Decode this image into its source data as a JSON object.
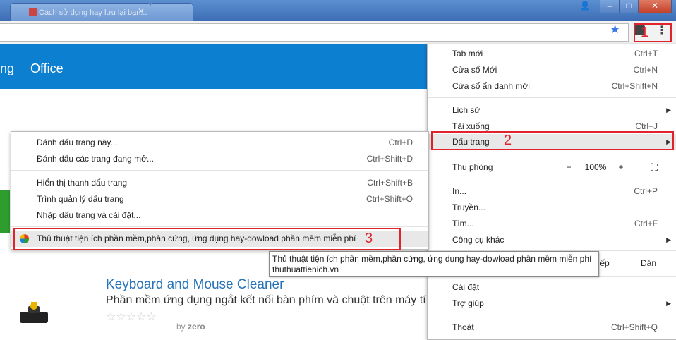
{
  "browser": {
    "tab_title": "Cách sử dụng hay lưu lại bạn...",
    "tab2_text": "",
    "window_buttons": {
      "user": "👤",
      "minimize": "–",
      "maximize": "□",
      "close": "✕"
    },
    "star_icon": "star-icon",
    "menu_icon": "⋮"
  },
  "annotations": {
    "n1": "1",
    "n2": "2",
    "n3": "3",
    "color": "#e0232d"
  },
  "site_nav": {
    "item_partial": "ng",
    "item_office": "Office",
    "color": "#0d7fd0"
  },
  "chrome_menu": {
    "items": [
      {
        "label": "Tab mới",
        "shortcut": "Ctrl+T"
      },
      {
        "label": "Cửa sổ Mới",
        "shortcut": "Ctrl+N"
      },
      {
        "label": "Cửa sổ ẩn danh mới",
        "shortcut": "Ctrl+Shift+N"
      },
      {
        "label": "Lịch sử",
        "shortcut": ""
      },
      {
        "label": "Tải xuống",
        "shortcut": "Ctrl+J"
      },
      {
        "label": "Dấu trang",
        "shortcut": ""
      }
    ],
    "zoom": {
      "label": "Thu phóng",
      "minus": "−",
      "value": "100%",
      "plus": "+"
    },
    "items2": [
      {
        "label": "In...",
        "shortcut": "Ctrl+P"
      },
      {
        "label": "Truyền...",
        "shortcut": ""
      },
      {
        "label": "Tìm...",
        "shortcut": "Ctrl+F"
      },
      {
        "label": "Công cụ khác",
        "shortcut": ""
      }
    ],
    "edit": {
      "paste": "ếp",
      "paste_full": "Dán"
    },
    "items3": [
      {
        "label": "Cài đặt"
      },
      {
        "label": "Trợ giúp"
      }
    ],
    "exit": {
      "label": "Thoát",
      "shortcut": "Ctrl+Shift+Q"
    }
  },
  "bookmarks_submenu": {
    "items": [
      {
        "label": "Đánh dấu trang này...",
        "shortcut": "Ctrl+D"
      },
      {
        "label": "Đánh dấu các trang đang mở...",
        "shortcut": "Ctrl+Shift+D"
      },
      {
        "label": "Hiển thị thanh dấu trang",
        "shortcut": "Ctrl+Shift+B"
      },
      {
        "label": "Trình quản lý dấu trang",
        "shortcut": "Ctrl+Shift+O"
      },
      {
        "label": "Nhập dấu trang và cài đặt...",
        "shortcut": ""
      }
    ],
    "bookmark": {
      "label": "Thủ thuật tiện ích phần mềm,phần cứng, ứng dụng hay-dowload phần mềm miễn phí"
    }
  },
  "tooltip": {
    "line1": "Thủ thuật tiện ích phần mềm,phần cứng, ứng dụng hay-dowload phần mềm miễn phí",
    "line2": "thuthuattienich.vn"
  },
  "page_content": {
    "title": "Keyboard and Mouse Cleaner",
    "description": "Phần mềm ứng dụng ngắt kết nối bàn phím và chuột trên máy tí",
    "rating": 0,
    "stars": "☆☆☆☆☆",
    "by_label": "by",
    "author": "zero"
  }
}
